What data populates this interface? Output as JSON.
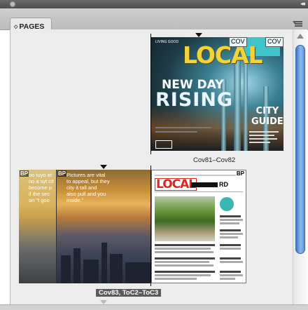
{
  "panel": {
    "tab_label": "PAGES",
    "tab_arrows": "◇",
    "collapse_glyph": "◂◂"
  },
  "spreads": [
    {
      "label": "Cov81–Cov82",
      "selected": false,
      "pages": [
        {
          "kind": "cover",
          "masthead": "LOCAL",
          "cov_tags": [
            "COV",
            "COV"
          ],
          "headline_top": "NEW DAY",
          "headline_main": "RISING",
          "guide": [
            "CITY",
            "GUIDE"
          ],
          "tiny_text": "LIVING GOOD"
        }
      ]
    },
    {
      "label": "Cov83, ToC2–ToC3",
      "selected": true,
      "pages": [
        {
          "kind": "toc-left",
          "master_tags": [
            "BP",
            "BP"
          ],
          "text_col1": "oo tuyo at\nno a syt cit\nbecome p\nif the sec\non \"t goo",
          "text_col2": "Pictures are vital\nto appeal, but they\ncity it tall and\nalso pull and you\ninside.\""
        },
        {
          "kind": "toc-right",
          "master_tag": "BP",
          "masthead": "LOCAL",
          "masthead_suffix": "RD"
        }
      ]
    }
  ],
  "colors": {
    "scroll_thumb": "#5a8fd6",
    "selected_label_bg": "#5b5b5b",
    "masthead_yellow": "#f3d33a",
    "masthead_red": "#d62b22",
    "cover_cyan": "#3fc4c9"
  }
}
